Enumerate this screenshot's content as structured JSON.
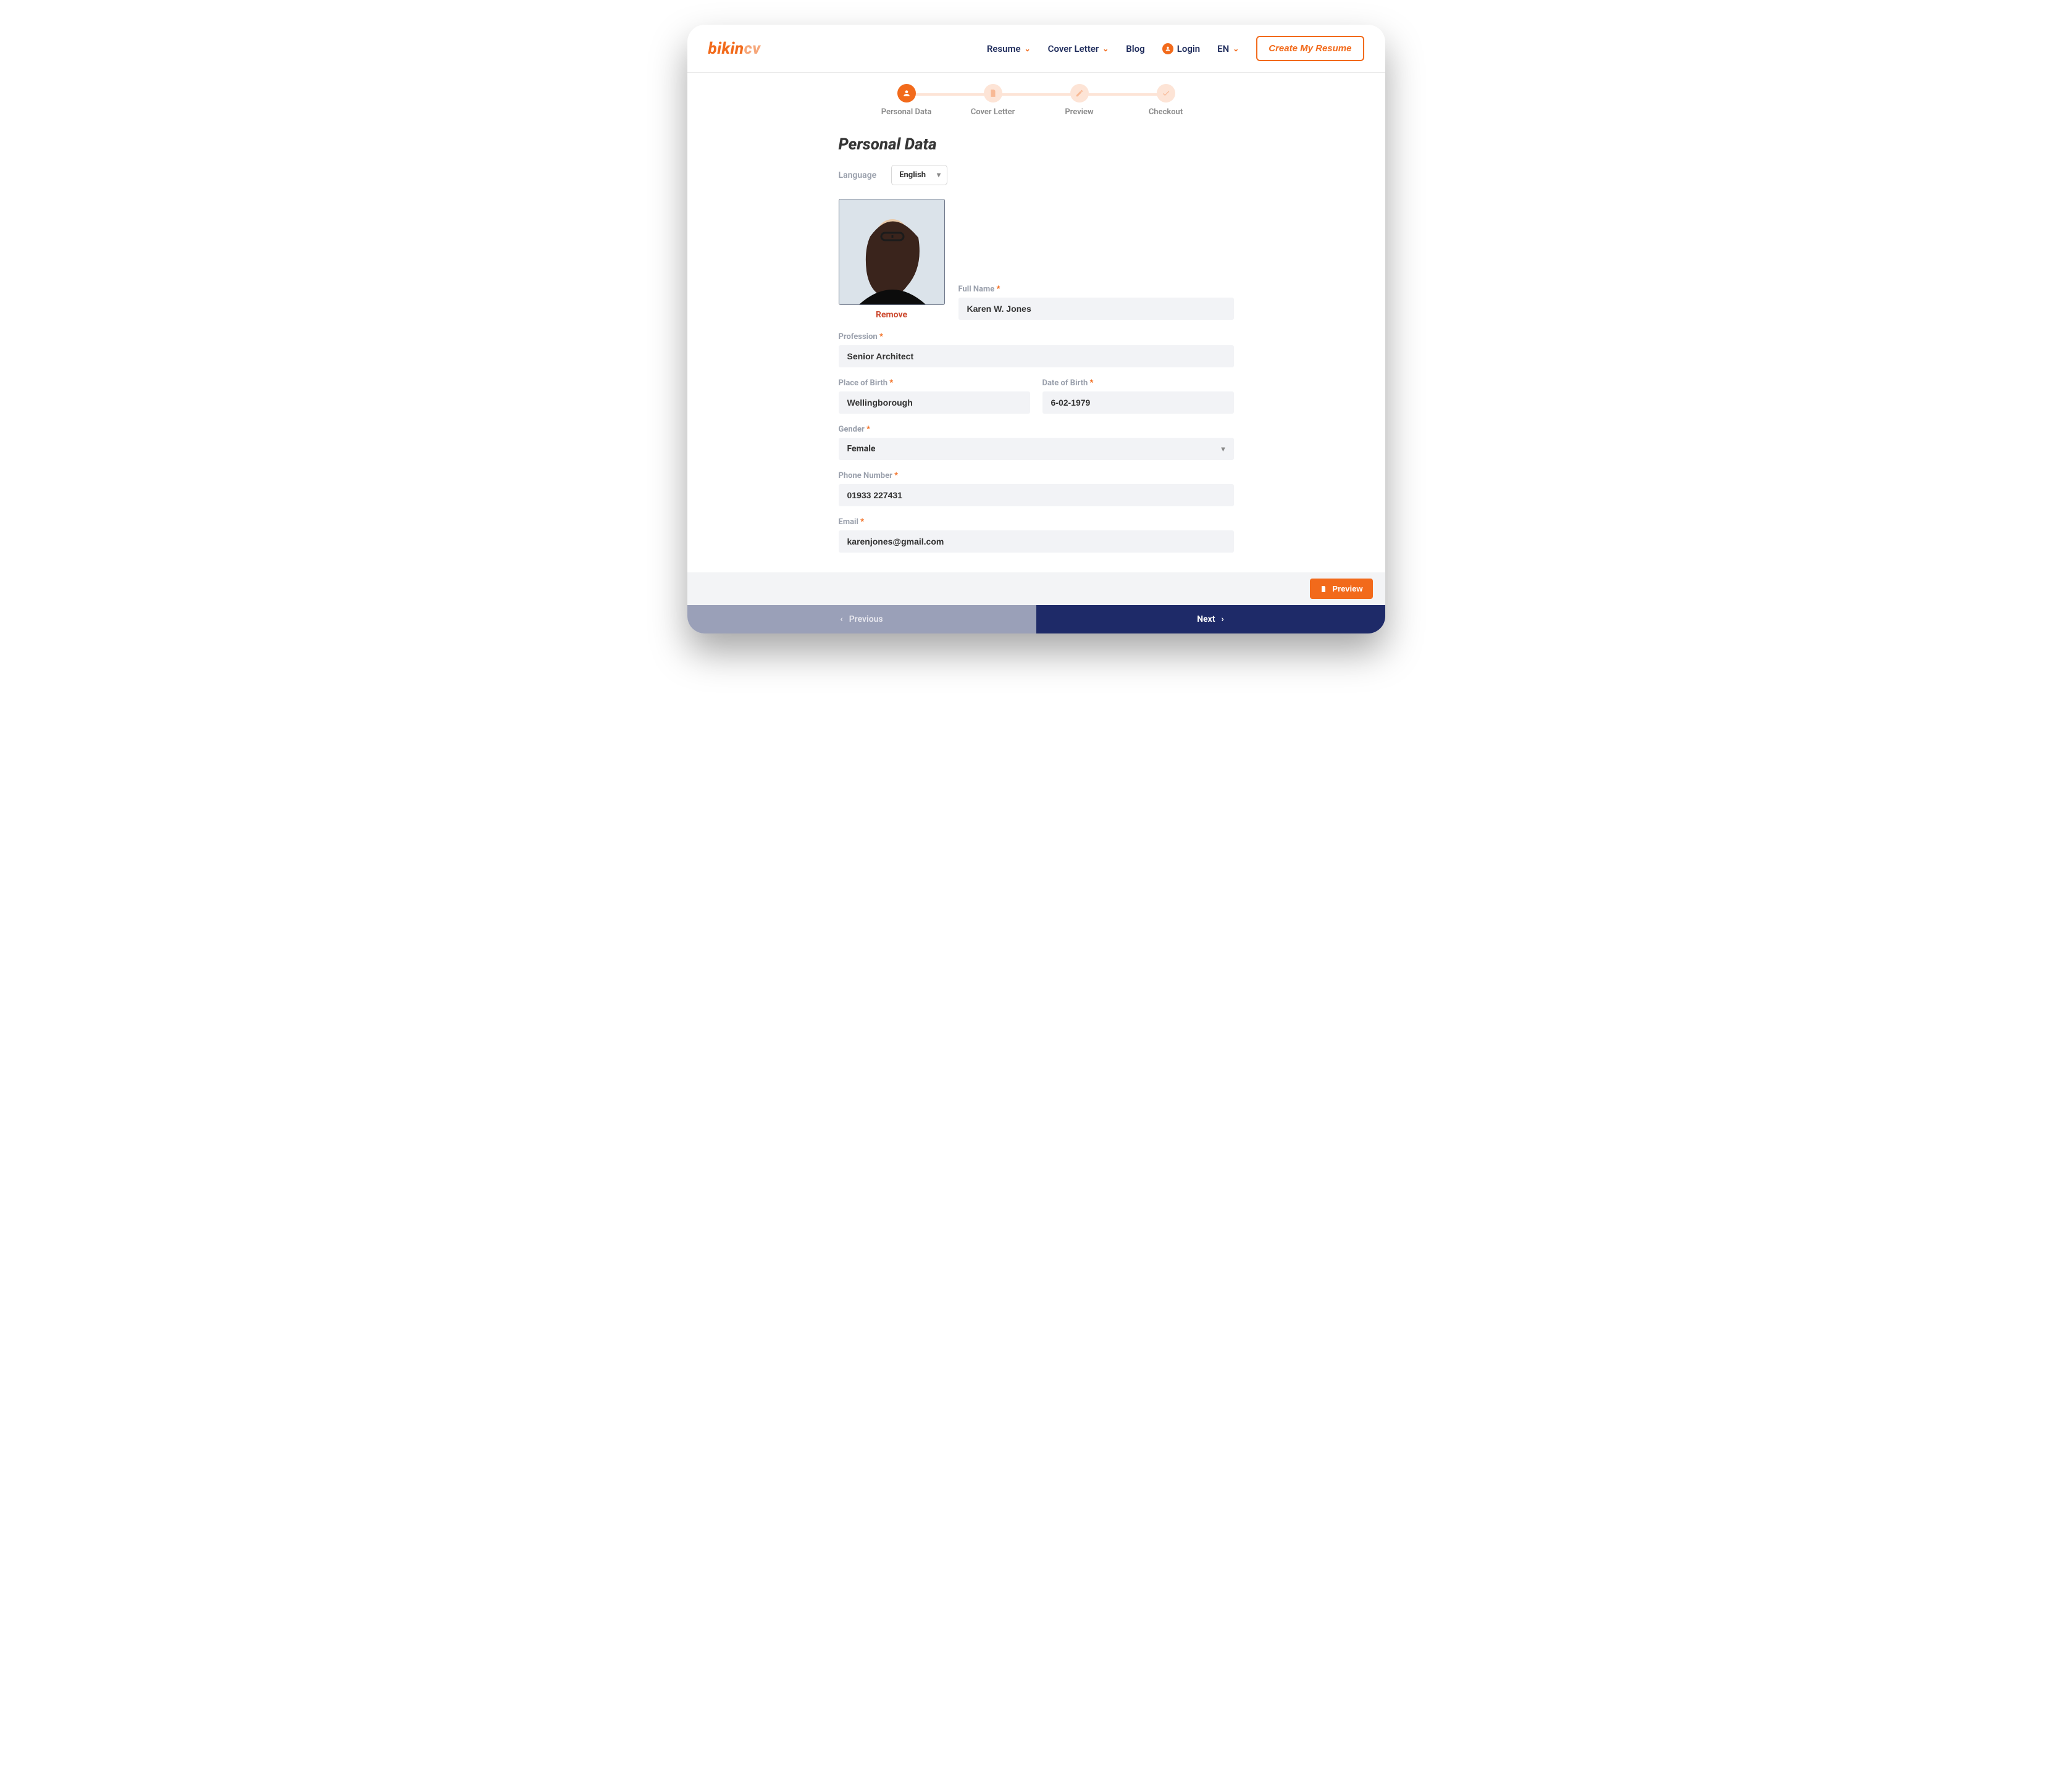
{
  "logo": {
    "p1": "bikin",
    "p2": "cv"
  },
  "nav": {
    "resume": "Resume",
    "coverLetter": "Cover Letter",
    "blog": "Blog",
    "login": "Login",
    "lang": "EN",
    "cta": "Create My Resume"
  },
  "steps": {
    "s1": "Personal Data",
    "s2": "Cover Letter",
    "s3": "Preview",
    "s4": "Checkout"
  },
  "page": {
    "title": "Personal Data"
  },
  "language": {
    "label": "Language",
    "value": "English"
  },
  "photo": {
    "remove": "Remove"
  },
  "fields": {
    "fullName": {
      "label": "Full Name",
      "value": "Karen W. Jones"
    },
    "profession": {
      "label": "Profession",
      "value": "Senior Architect"
    },
    "placeOfBirth": {
      "label": "Place of Birth",
      "value": "Wellingborough"
    },
    "dateOfBirth": {
      "label": "Date of Birth",
      "value": "6-02-1979"
    },
    "gender": {
      "label": "Gender",
      "value": "Female"
    },
    "phone": {
      "label": "Phone Number",
      "value": "01933 227431"
    },
    "email": {
      "label": "Email",
      "value": "karenjones@gmail.com"
    }
  },
  "footer": {
    "preview": "Preview",
    "previous": "Previous",
    "next": "Next"
  },
  "required": "*"
}
